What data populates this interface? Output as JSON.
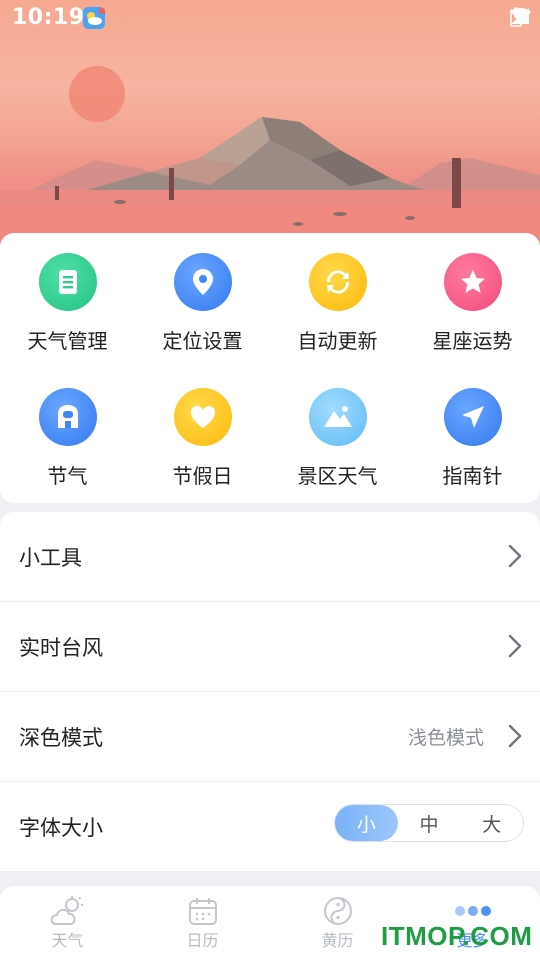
{
  "status_bar": {
    "time": "10:19"
  },
  "colors": {
    "accent": "#4d8ff2",
    "green": "#2ecb8e",
    "blue": "#3f86f4",
    "yellow": "#ffc21a",
    "pink": "#f65b88",
    "sky": "#79c9f7",
    "chevron": "#6f7680"
  },
  "features": [
    {
      "label": "天气管理",
      "icon": "list-doc-icon",
      "color": "#2ecb8e"
    },
    {
      "label": "定位设置",
      "icon": "location-pin-icon",
      "color": "#3f86f4"
    },
    {
      "label": "自动更新",
      "icon": "refresh-icon",
      "color": "#ffc21a"
    },
    {
      "label": "星座运势",
      "icon": "star-icon",
      "color": "#f65b88"
    },
    {
      "label": "节气",
      "icon": "solar-term-icon",
      "color": "#3f86f4"
    },
    {
      "label": "节假日",
      "icon": "heart-icon",
      "color": "#ffc21a"
    },
    {
      "label": "景区天气",
      "icon": "mountain-icon",
      "color": "#79c9f7"
    },
    {
      "label": "指南针",
      "icon": "compass-arrow-icon",
      "color": "#3f86f4"
    }
  ],
  "settings": {
    "tools": {
      "title": "小工具"
    },
    "typhoon": {
      "title": "实时台风"
    },
    "dark_mode": {
      "title": "深色模式",
      "value": "浅色模式"
    },
    "font_size": {
      "title": "字体大小",
      "options": [
        "小",
        "中",
        "大"
      ],
      "selected": "小"
    }
  },
  "nav": {
    "weather": "天气",
    "calendar": "日历",
    "almanac": "黄历",
    "more": "更多"
  },
  "watermark": "ITMOP.COM"
}
